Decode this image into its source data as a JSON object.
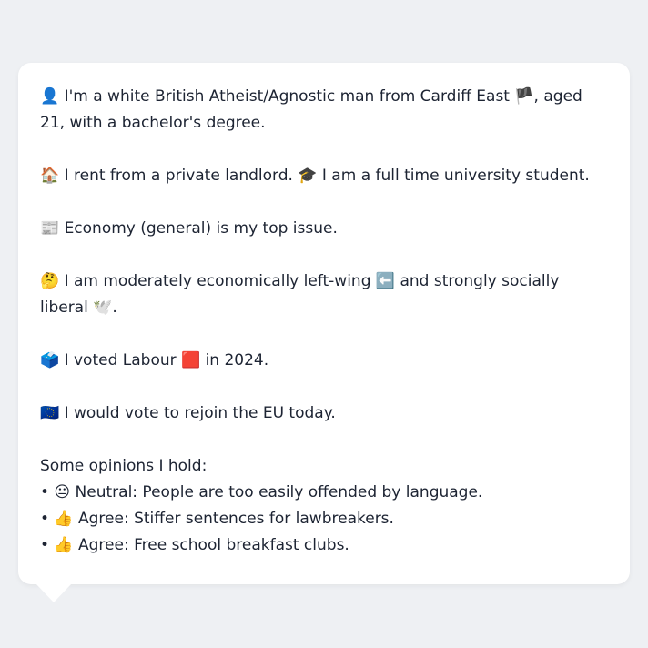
{
  "profile": {
    "p1": "👤 I'm a white British Atheist/Agnostic man from Cardiff East 🏴, aged 21, with a bachelor's degree.",
    "p2": "🏠 I rent from a private landlord. 🎓 I am a full time university student.",
    "p3": "📰 Economy (general) is my top issue.",
    "p4": "🤔 I am moderately economically left-wing ⬅️ and strongly socially liberal 🕊️.",
    "p5": "🗳️ I voted Labour 🟥 in 2024.",
    "p6": "🇪🇺 I would vote to rejoin the EU today.",
    "opinions_heading": "Some opinions I hold:",
    "opinions": [
      "• 😐 Neutral: People are too easily offended by language.",
      "• 👍 Agree: Stiffer sentences for lawbreakers.",
      "• 👍 Agree: Free school breakfast clubs."
    ]
  }
}
